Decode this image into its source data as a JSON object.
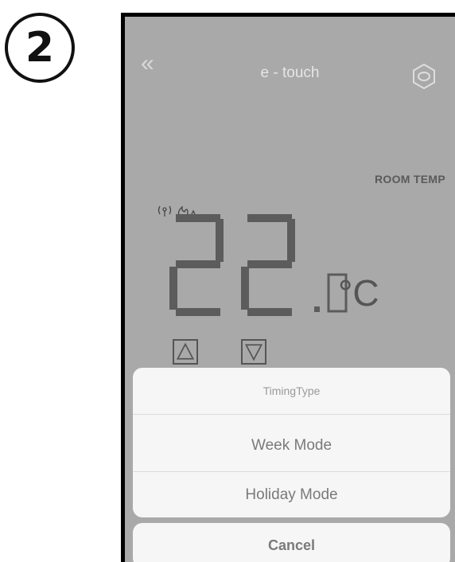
{
  "step": {
    "number": "2"
  },
  "header": {
    "title": "e - touch",
    "back_icon": "double-chevron-left-icon",
    "settings_icon": "hexagon-settings-icon"
  },
  "display": {
    "room_temp_label": "ROOM TEMP",
    "temperature": "22.0",
    "unit": "°C",
    "indicators": [
      "signal-icon",
      "flame-icon"
    ]
  },
  "controls": {
    "up_icon": "triangle-up-icon",
    "down_icon": "triangle-down-icon"
  },
  "action_sheet": {
    "title": "TimingType",
    "options": [
      "Week Mode",
      "Holiday Mode"
    ],
    "cancel_label": "Cancel"
  },
  "colors": {
    "screen_bg": "#a9a9a9",
    "sheet_bg": "#f6f6f6",
    "text_dim": "#7a7a7a"
  }
}
